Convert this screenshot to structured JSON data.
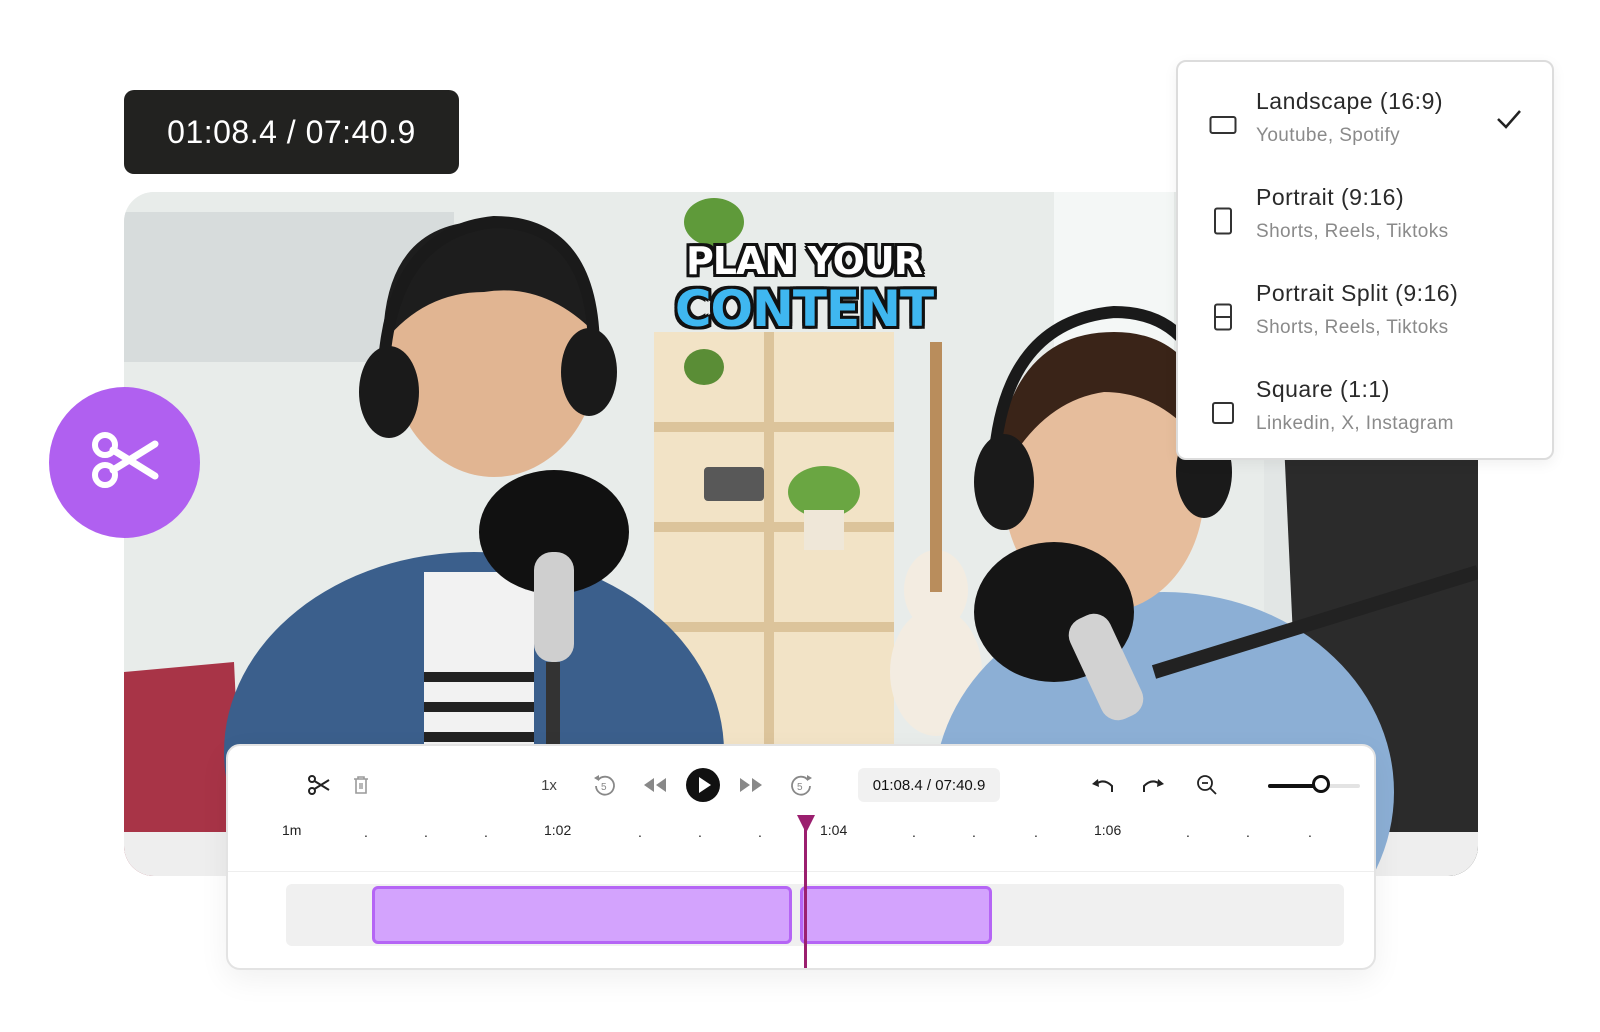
{
  "time_badge": "01:08.4 / 07:40.9",
  "video": {
    "caption_line1": "PLAN YOUR",
    "caption_line2": "CONTENT",
    "caption_accent": "#3fb7f0"
  },
  "scissors_badge": {
    "icon": "scissors-icon",
    "color": "#b060f0"
  },
  "aspect_menu": {
    "items": [
      {
        "title": "Landscape (16:9)",
        "subtitle": "Youtube, Spotify",
        "icon": "landscape-icon",
        "selected": true
      },
      {
        "title": "Portrait (9:16)",
        "subtitle": "Shorts, Reels, Tiktoks",
        "icon": "portrait-icon",
        "selected": false
      },
      {
        "title": "Portrait Split (9:16)",
        "subtitle": "Shorts, Reels, Tiktoks",
        "icon": "portrait-split-icon",
        "selected": false
      },
      {
        "title": "Square (1:1)",
        "subtitle": "Linkedin, X, Instagram",
        "icon": "square-icon",
        "selected": false
      }
    ]
  },
  "editor": {
    "speed": "1x",
    "time": "01:08.4 / 07:40.9",
    "ruler_labels": [
      "1m",
      "1:02",
      "1:04",
      "1:06"
    ],
    "ruler_dot": ".",
    "clip_color": "#d3a3fd",
    "playhead_color": "#9b1f6f",
    "zoom_level": 0.57,
    "icons": [
      "scissors-icon",
      "trash-icon",
      "rewind-5-icon",
      "skip-back-icon",
      "play-icon",
      "skip-forward-icon",
      "forward-5-icon",
      "undo-icon",
      "redo-icon",
      "zoom-out-icon"
    ]
  }
}
